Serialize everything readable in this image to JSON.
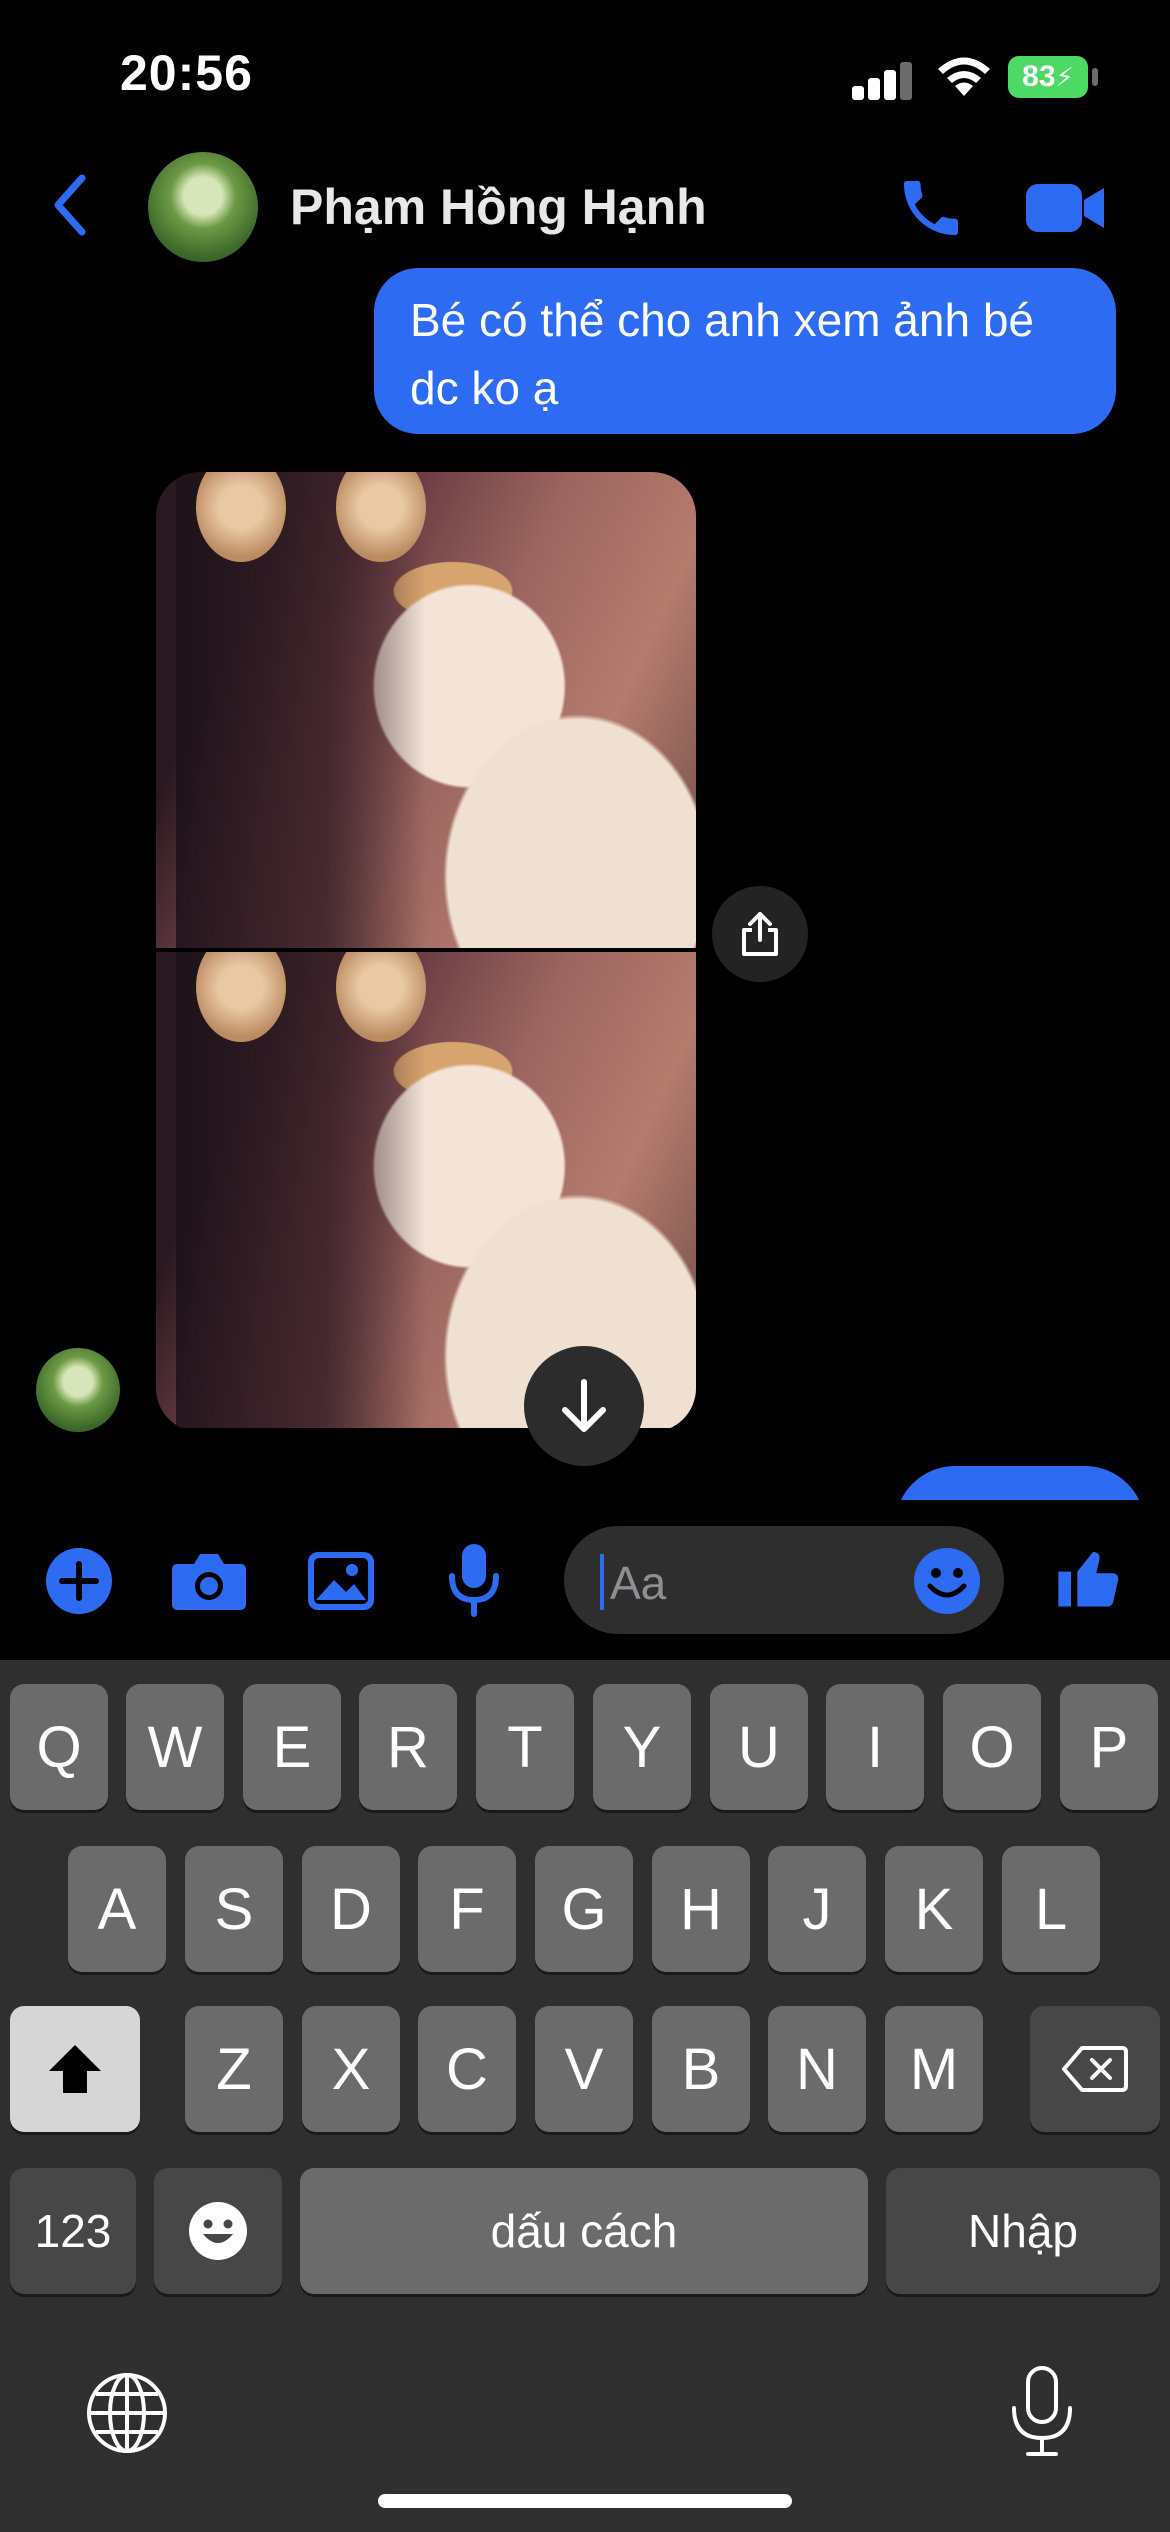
{
  "status_bar": {
    "time": "20:56",
    "battery": "83"
  },
  "header": {
    "contact_name": "Phạm Hồng Hạnh"
  },
  "messages": [
    {
      "direction": "outgoing",
      "text": "Bé có thể cho anh xem ảnh bé dc ko ạ"
    }
  ],
  "composer": {
    "placeholder": "Aa"
  },
  "keyboard": {
    "row1": [
      "Q",
      "W",
      "E",
      "R",
      "T",
      "Y",
      "U",
      "I",
      "O",
      "P"
    ],
    "row2": [
      "A",
      "S",
      "D",
      "F",
      "G",
      "H",
      "J",
      "K",
      "L"
    ],
    "row3": [
      "Z",
      "X",
      "C",
      "V",
      "B",
      "N",
      "M"
    ],
    "numbers_label": "123",
    "space_label": "dấu cách",
    "return_label": "Nhập"
  },
  "colors": {
    "accent": "#2d6bf3",
    "battery": "#4cd964",
    "background": "#000000"
  }
}
